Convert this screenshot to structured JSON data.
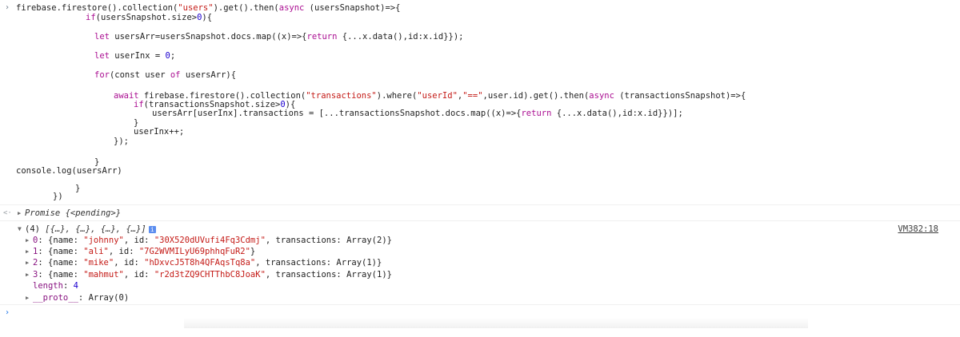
{
  "console": {
    "command_lines": [
      "firebase.firestore().collection(\"users\").get().then(async (usersSnapshot)=>{",
      "if(usersSnapshot.size>0){",
      "let usersArr=usersSnapshot.docs.map((x)=>{return {...x.data(),id:x.id}});",
      "let userInx = 0;",
      "for(const user of usersArr){",
      "await firebase.firestore().collection(\"transactions\").where(\"userId\",\"==\",user.id).get().then(async (transactionsSnapshot)=>{",
      "if(transactionsSnapshot.size>0){",
      "usersArr[userInx].transactions = [...transactionsSnapshot.docs.map((x)=>{return {...x.data(),id:x.id}})];",
      "}",
      "userInx++;",
      "});",
      "}",
      "console.log(usersArr)",
      "}",
      "})"
    ],
    "tokens": {
      "firebase": "firebase",
      "firestore_call": ".firestore().collection(",
      "users": "\"users\"",
      "get_then": ").get().then(",
      "async": "async",
      "users_snapshot_param": " (usersSnapshot)=>{",
      "if": "if",
      "users_size": "(usersSnapshot.size>",
      "zero": "0",
      "close_brace_open": "){",
      "let": "let",
      "users_arr_assign": " usersArr=usersSnapshot.docs.map((x)=>{",
      "return": "return",
      "spread_data": " {...x.data(),id:x.id}});",
      "user_inx_decl": " userInx = ",
      "semi": ";",
      "for": "for",
      "const": "(const",
      "user_of": " user ",
      "of": "of",
      "users_arr_loop": " usersArr){",
      "await": "await",
      "firebase2": " firebase.firestore().collection(",
      "transactions": "\"transactions\"",
      "where": ").where(",
      "user_id": "\"userId\"",
      "comma": ",",
      "eqeq": "\"==\"",
      "user_id_get": ",user.id).get().then(",
      "tx_param": " (transactionsSnapshot)=>{",
      "tx_size": "(transactionsSnapshot.size>",
      "assign_tx": "usersArr[userInx].transactions = [...transactionsSnapshot.docs.map((x)=>{",
      "spread_data2": " {...x.data(),id:x.id}})];",
      "brace": "}",
      "user_inx_inc": "userInx++;",
      "close_paren": "});",
      "console_log": "console.log(usersArr)",
      "brace_paren": "})"
    },
    "promise": {
      "label": "Promise",
      "state": "{<pending>}"
    },
    "log": {
      "source_link": "VM382:18",
      "summary_count": "(4)",
      "summary_items": "[{…}, {…}, {…}, {…}]",
      "entries": [
        {
          "index": "0",
          "name": "\"johnny\"",
          "id": "\"30X520dUVufi4Fq3Cdmj\"",
          "transactions": "Array(2)"
        },
        {
          "index": "1",
          "name": "\"ali\"",
          "id": "\"7G2WVMILyU69phhqFuR2\"",
          "transactions": ""
        },
        {
          "index": "2",
          "name": "\"mike\"",
          "id": "\"hDxvcJ5T8h4QFAqsTq8a\"",
          "transactions": "Array(1)"
        },
        {
          "index": "3",
          "name": "\"mahmut\"",
          "id": "\"r2d3tZQ9CHTThbC8JoaK\"",
          "transactions": "Array(1)"
        }
      ],
      "length_label": "length",
      "length_value": "4",
      "proto_label": "__proto__",
      "proto_value": "Array(0)"
    },
    "labels": {
      "name_key": "name",
      "id_key": "id",
      "transactions_key": "transactions",
      "colon_sp": ": ",
      "comma_sp": ", ",
      "open_brace": "{",
      "close_brace": "}"
    },
    "icons": {
      "prompt": "chevron-right-icon",
      "return": "return-arrow-icon",
      "info": "info-icon",
      "expand": "disclosure-triangle-icon"
    },
    "colors": {
      "keyword": "#aa0d91",
      "string": "#c41a16",
      "number": "#1c00cf",
      "property": "#881280",
      "prompt": "#1a73e8"
    }
  }
}
